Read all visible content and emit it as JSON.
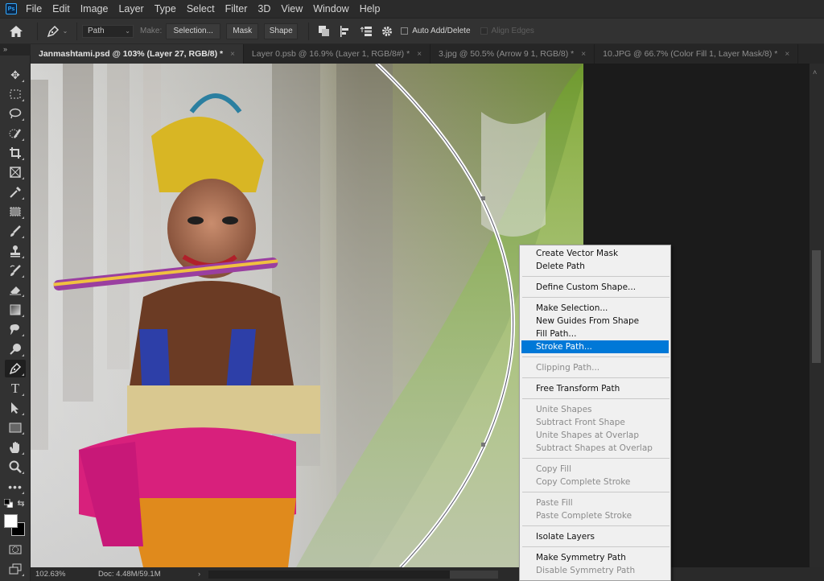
{
  "app": {
    "logo": "Ps"
  },
  "menubar": {
    "items": [
      "File",
      "Edit",
      "Image",
      "Layer",
      "Type",
      "Select",
      "Filter",
      "3D",
      "View",
      "Window",
      "Help"
    ]
  },
  "options": {
    "home_icon": "home-icon",
    "tool_icon": "pen-tool-icon",
    "mode_select": "Path",
    "make_label": "Make:",
    "selection_btn": "Selection...",
    "mask_btn": "Mask",
    "shape_btn": "Shape",
    "auto_add_delete": {
      "label": "Auto Add/Delete",
      "checked": false
    },
    "align_edges": {
      "label": "Align Edges",
      "checked": false,
      "disabled": true
    }
  },
  "tabs": [
    {
      "label": "Janmashtami.psd @ 103% (Layer 27, RGB/8) *",
      "active": true
    },
    {
      "label": "Layer 0.psb @ 16.9% (Layer 1, RGB/8#) *",
      "active": false
    },
    {
      "label": "3.jpg @ 50.5% (Arrow 9 1, RGB/8) *",
      "active": false
    },
    {
      "label": "10.JPG @ 66.7% (Color Fill 1, Layer Mask/8) *",
      "active": false
    }
  ],
  "tab_close": "×",
  "panel_collapse": "»",
  "toolbar": {
    "tools": [
      "move",
      "marquee",
      "lasso",
      "quick-selection",
      "crop",
      "frame",
      "eyedropper",
      "healing-brush",
      "brush",
      "clone-stamp",
      "history-brush",
      "eraser",
      "gradient",
      "blur",
      "dodge",
      "pen",
      "type",
      "path-selection",
      "rectangle",
      "hand",
      "zoom",
      "more"
    ],
    "active_tool": "pen",
    "foreground_color": "#ffffff",
    "background_color": "#000000"
  },
  "status": {
    "zoom": "102.63%",
    "doc": "Doc: 4.48M/59.1M",
    "arrow": "›"
  },
  "context_menu": {
    "highlighted": "Stroke Path...",
    "groups": [
      [
        {
          "label": "Create Vector Mask",
          "enabled": true
        },
        {
          "label": "Delete Path",
          "enabled": true
        }
      ],
      [
        {
          "label": "Define Custom Shape...",
          "enabled": true
        }
      ],
      [
        {
          "label": "Make Selection...",
          "enabled": true
        },
        {
          "label": "New Guides From Shape",
          "enabled": true
        },
        {
          "label": "Fill Path...",
          "enabled": true
        },
        {
          "label": "Stroke Path...",
          "enabled": true
        }
      ],
      [
        {
          "label": "Clipping Path...",
          "enabled": false
        }
      ],
      [
        {
          "label": "Free Transform Path",
          "enabled": true
        }
      ],
      [
        {
          "label": "Unite Shapes",
          "enabled": false
        },
        {
          "label": "Subtract Front Shape",
          "enabled": false
        },
        {
          "label": "Unite Shapes at Overlap",
          "enabled": false
        },
        {
          "label": "Subtract Shapes at Overlap",
          "enabled": false
        }
      ],
      [
        {
          "label": "Copy Fill",
          "enabled": false
        },
        {
          "label": "Copy Complete Stroke",
          "enabled": false
        }
      ],
      [
        {
          "label": "Paste Fill",
          "enabled": false
        },
        {
          "label": "Paste Complete Stroke",
          "enabled": false
        }
      ],
      [
        {
          "label": "Isolate Layers",
          "enabled": true
        }
      ],
      [
        {
          "label": "Make Symmetry Path",
          "enabled": true
        },
        {
          "label": "Disable Symmetry Path",
          "enabled": false
        }
      ]
    ]
  },
  "colors": {
    "highlight": "#0078d7",
    "ui_dark": "#323232",
    "canvas_bg": "#1b1b1b"
  }
}
